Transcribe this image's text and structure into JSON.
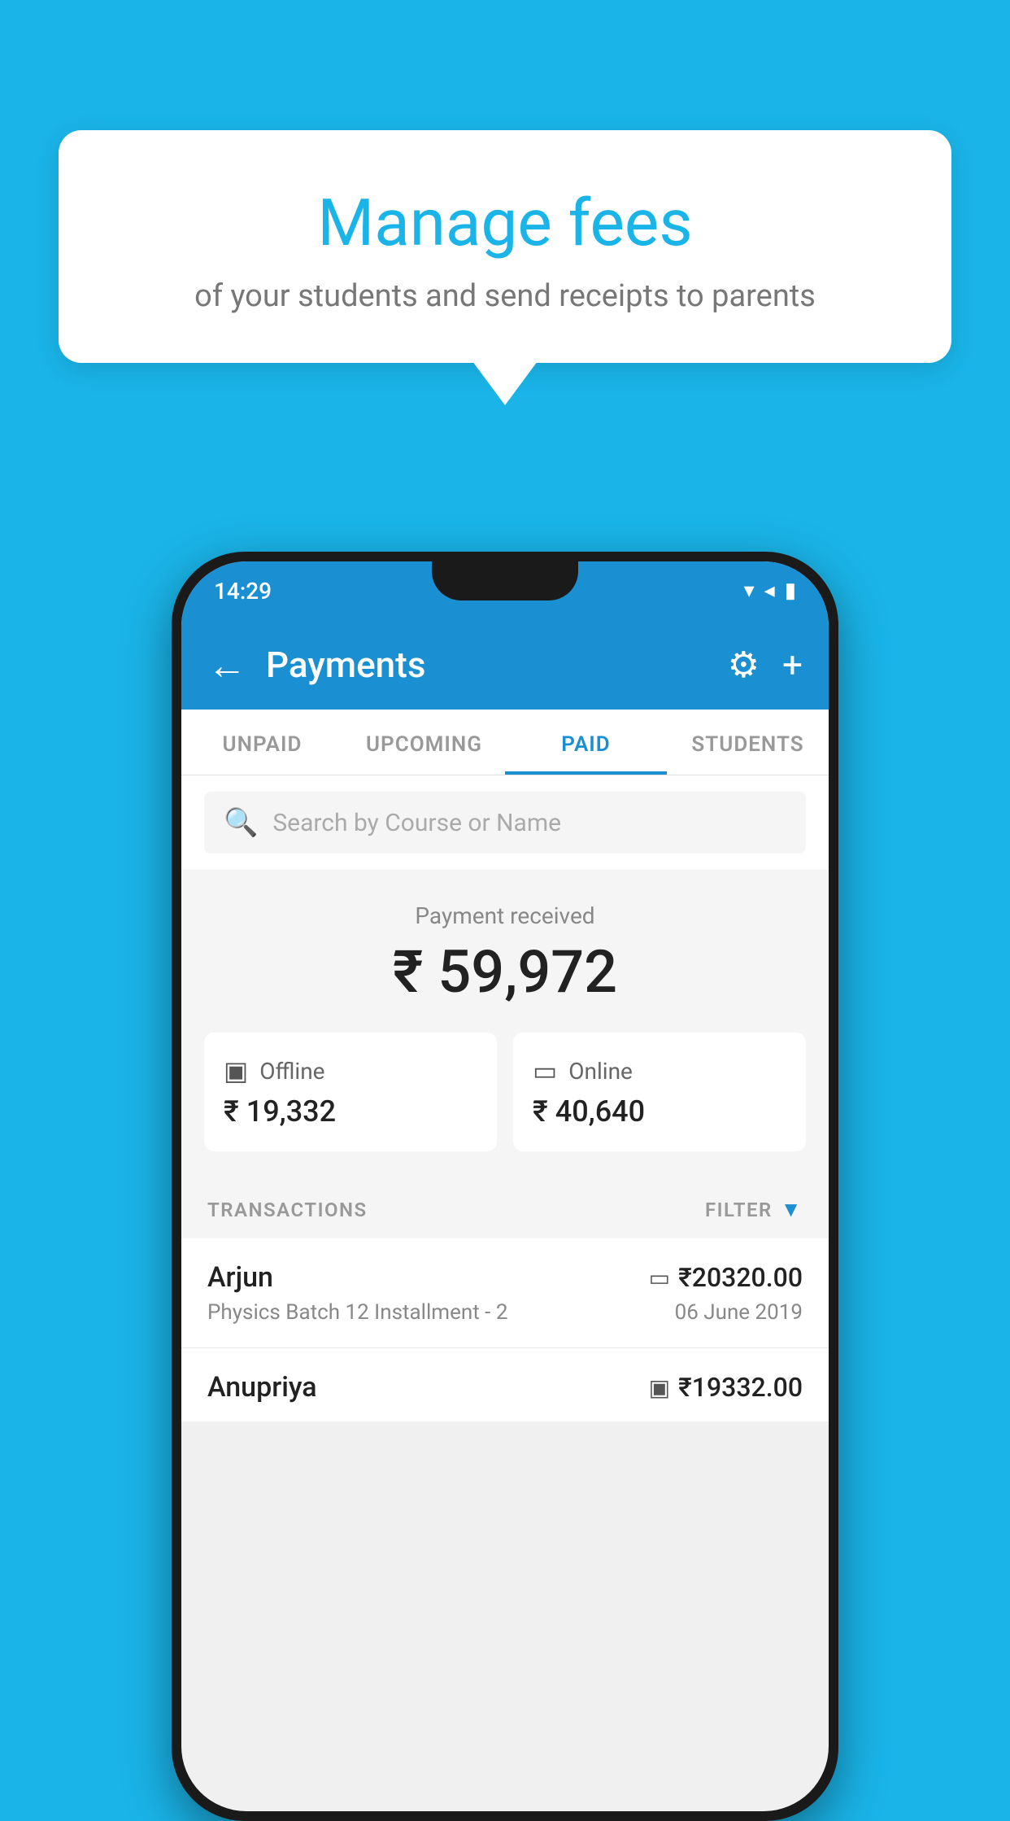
{
  "background": {
    "color": "#1ab4e8"
  },
  "speech_bubble": {
    "title": "Manage fees",
    "subtitle": "of your students and send receipts to parents"
  },
  "phone": {
    "status_bar": {
      "time": "14:29",
      "icons": "▾◂▮"
    },
    "app_bar": {
      "title": "Payments",
      "back_label": "←",
      "settings_label": "⚙",
      "add_label": "+"
    },
    "tabs": [
      {
        "label": "UNPAID",
        "active": false
      },
      {
        "label": "UPCOMING",
        "active": false
      },
      {
        "label": "PAID",
        "active": true
      },
      {
        "label": "STUDENTS",
        "active": false
      }
    ],
    "search": {
      "placeholder": "Search by Course or Name"
    },
    "payment_summary": {
      "label": "Payment received",
      "amount": "₹ 59,972"
    },
    "payment_cards": [
      {
        "type": "Offline",
        "icon": "💳",
        "amount": "₹ 19,332"
      },
      {
        "type": "Online",
        "icon": "💳",
        "amount": "₹ 40,640"
      }
    ],
    "transactions_section": {
      "label": "TRANSACTIONS",
      "filter_label": "FILTER",
      "rows": [
        {
          "name": "Arjun",
          "course": "Physics Batch 12 Installment - 2",
          "amount": "₹20320.00",
          "date": "06 June 2019",
          "payment_type": "online"
        },
        {
          "name": "Anupriya",
          "course": "",
          "amount": "₹19332.00",
          "date": "",
          "payment_type": "offline"
        }
      ]
    }
  }
}
